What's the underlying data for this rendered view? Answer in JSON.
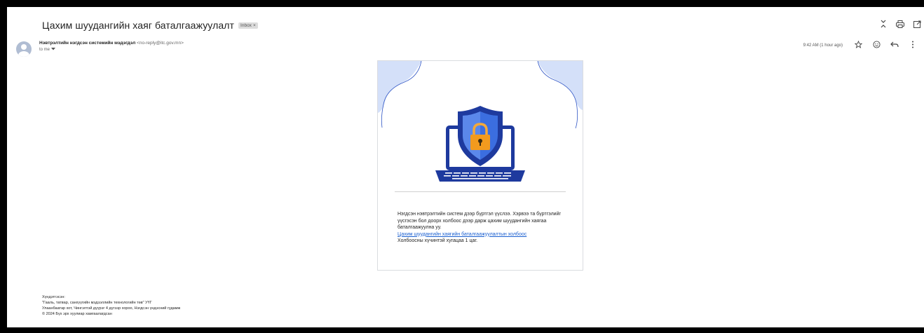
{
  "email": {
    "subject": "Цахим шуудангийн хаяг баталгаажуулалт",
    "label": "Inbox",
    "label_close": "×",
    "sender_name": "Нэвтрэлтийн нэгдсэн системийн мэдэгдэл",
    "sender_email": "<no-reply@itc.gov.mn>",
    "to": "to me",
    "time": "9:42 AM (1 hour ago)"
  },
  "icons": {
    "expand": "expand-icon",
    "print": "print-icon",
    "open_new": "open-in-new-window-icon",
    "star": "star-icon",
    "emoji": "emoji-icon",
    "reply": "reply-icon",
    "more": "more-vert-icon",
    "dropdown": "chevron-down-icon",
    "illustration": "laptop-shield-lock-icon"
  },
  "body": {
    "line1": "Нэгдсэн нэвтрэлтийн систем дээр бүртгэл үүслээ. Хэрвээ та бүртгэлийг үүсгэсэн бол доорх холбоос дээр дарж цахим шуудангийн хаягаа баталгаажуулна уу.",
    "link": "Цахим шуудангийн хаягийн баталгаажуулалтын холбоос",
    "line2": "Холбоосны хүчинтэй хугацаа 1 цаг."
  },
  "footer": {
    "line1": "Хүндэтгэсэн:",
    "line2": "\"Гааль, татвар, санхүүгийн мэдээллийн технологийн төв\" УҮГ",
    "line3": "Улаанбаатар хот, Чингэлтэй дүүрэг 4 дүгээр хороо, Нэгдсэн үндэсний гудамж",
    "line4": "© 2024 Бүх эрх хуулиар хамгаалагдсан"
  },
  "colors": {
    "shield_dark": "#1e3a9e",
    "shield_light": "#3b6ee0",
    "lock": "#f29a1e",
    "wave": "#c9d8f7",
    "link": "#1a5fd0"
  }
}
